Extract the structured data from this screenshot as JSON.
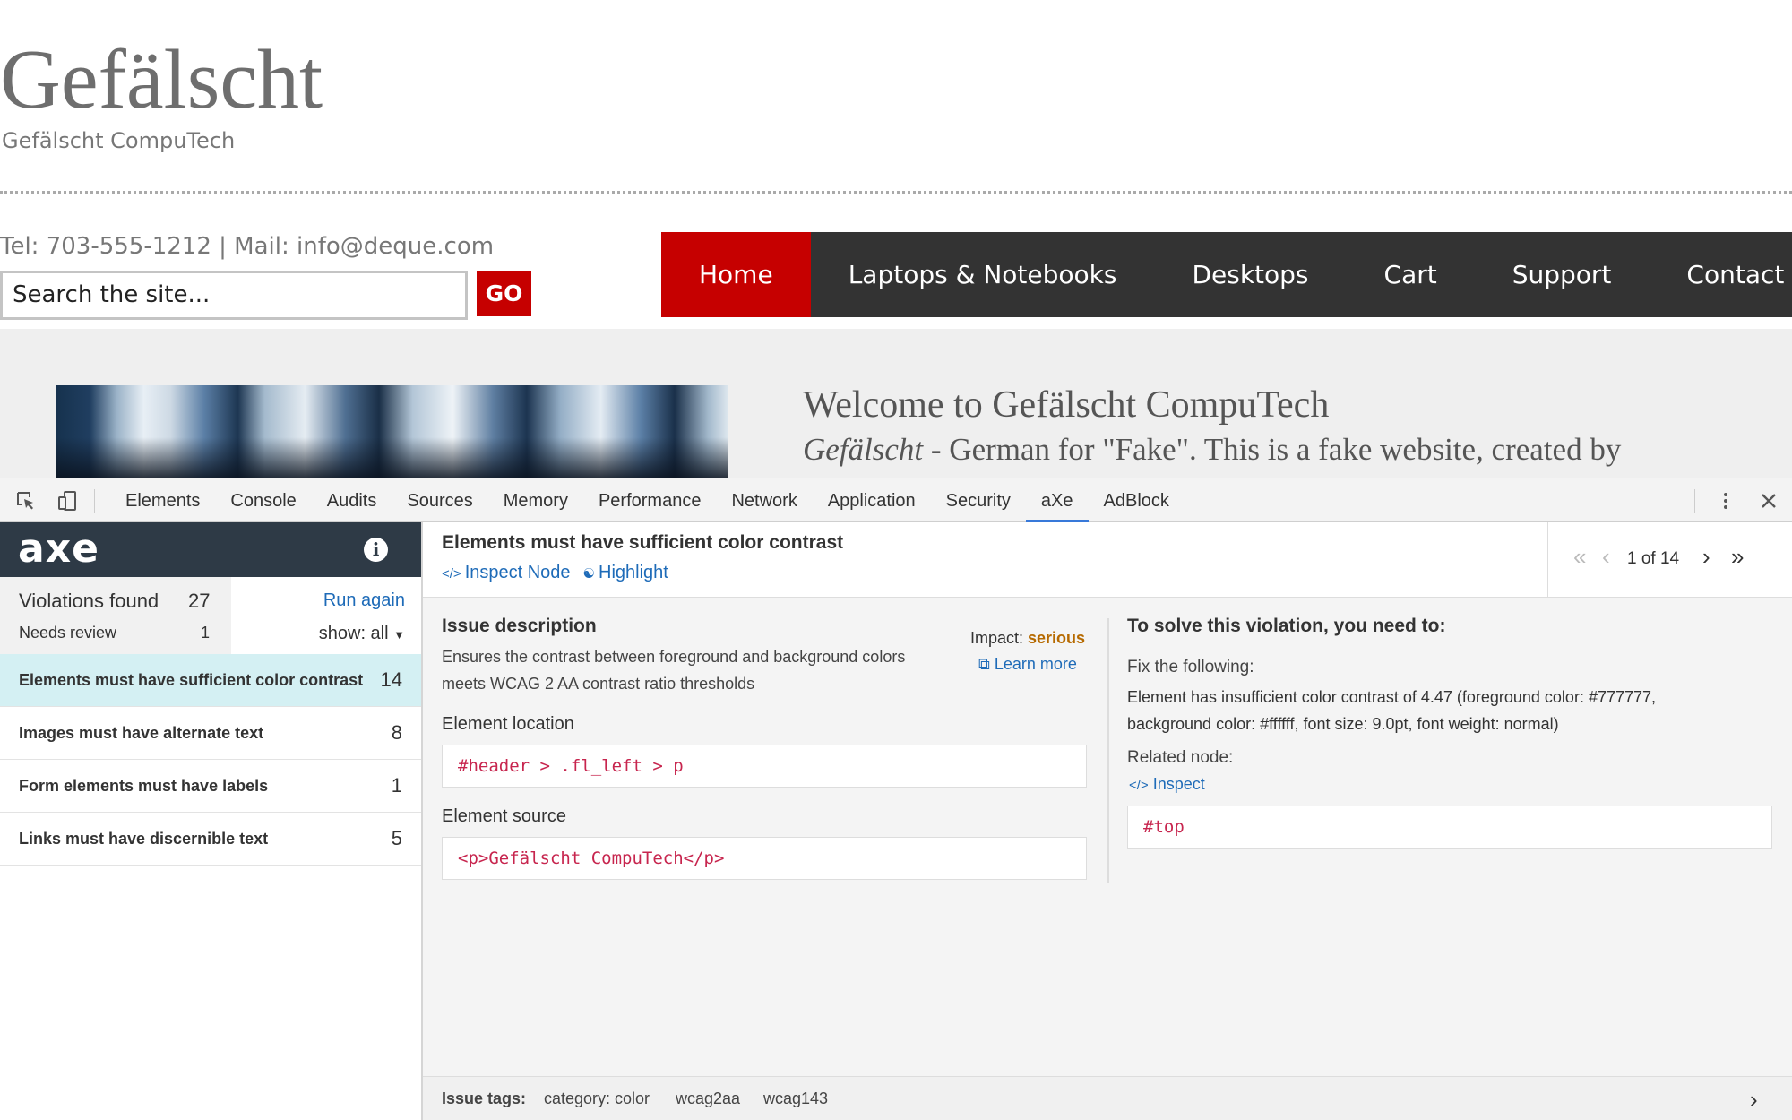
{
  "site": {
    "title": "Gefälscht",
    "subtitle": "Gefälscht CompuTech",
    "contact": "Tel: 703-555-1212 | Mail: info@deque.com",
    "search_placeholder": "Search the site...",
    "go_label": "GO",
    "nav": [
      "Home",
      "Laptops & Notebooks",
      "Desktops",
      "Cart",
      "Support",
      "Contact"
    ],
    "welcome_title": "Welcome to Gefälscht CompuTech",
    "welcome_em": "Gefälscht",
    "welcome_rest": " - German for \"Fake\". This is a fake website, created by",
    "accent_color": "#c60000"
  },
  "devtools": {
    "tabs": [
      "Elements",
      "Console",
      "Audits",
      "Sources",
      "Memory",
      "Performance",
      "Network",
      "Application",
      "Security",
      "aXe",
      "AdBlock"
    ],
    "active_tab": "aXe",
    "icons": [
      "inspect-element-icon",
      "device-toggle-icon",
      "more-vert-icon",
      "close-icon"
    ]
  },
  "axe": {
    "logo": "axe",
    "violations_label": "Violations found",
    "violations_count": "27",
    "needs_review_label": "Needs review",
    "needs_review_count": "1",
    "run_again": "Run again",
    "show_label": "show: all",
    "issues": [
      {
        "label": "Elements must have sufficient color contrast",
        "count": "14"
      },
      {
        "label": "Images must have alternate text",
        "count": "8"
      },
      {
        "label": "Form elements must have labels",
        "count": "1"
      },
      {
        "label": "Links must have discernible text",
        "count": "5"
      }
    ]
  },
  "detail": {
    "title": "Elements must have sufficient color contrast",
    "inspect_node": "Inspect Node",
    "highlight": "Highlight",
    "pager_text": "1 of 14",
    "issue_description_head": "Issue description",
    "issue_description": "Ensures the contrast between foreground and background colors meets WCAG 2 AA contrast ratio thresholds",
    "impact_label": "Impact: ",
    "impact_value": "serious",
    "learn_more": "Learn more",
    "element_location_label": "Element location",
    "element_location": "#header > .fl_left > p",
    "element_source_label": "Element source",
    "element_source": "<p>Gefälscht CompuTech</p>",
    "solve_head": "To solve this violation, you need to:",
    "fix_label": "Fix the following:",
    "fix_text": "Element has insufficient color contrast of 4.47 (foreground color: #777777, background color: #ffffff, font size: 9.0pt, font weight: normal)",
    "related_label": "Related node:",
    "inspect": "Inspect",
    "related_node": "#top",
    "tags_label": "Issue tags:",
    "tags": [
      "category: color",
      "wcag2aa",
      "wcag143"
    ]
  }
}
